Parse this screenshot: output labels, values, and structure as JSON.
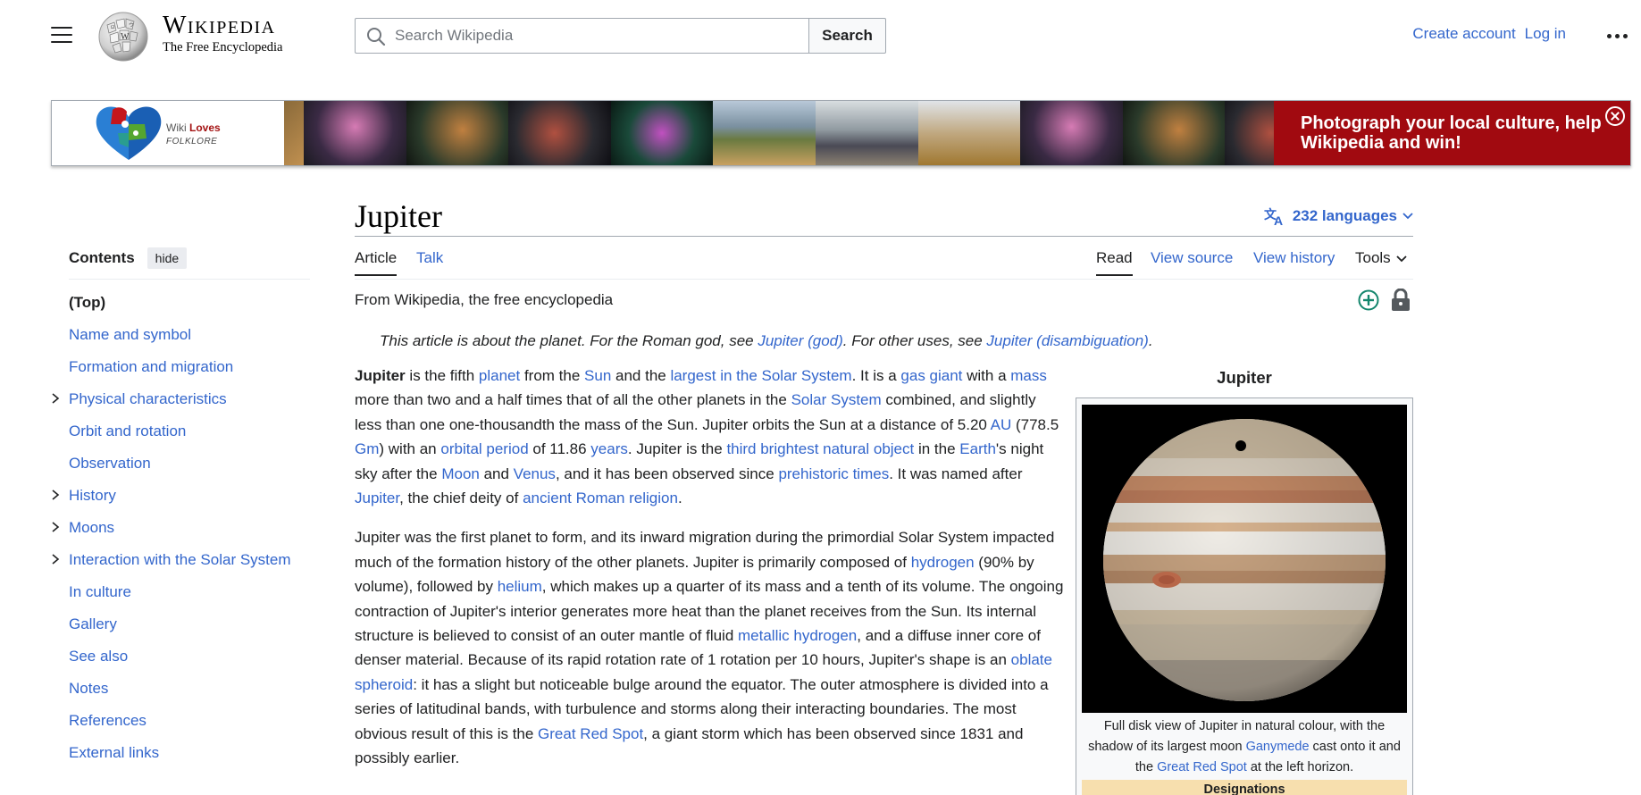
{
  "header": {
    "wordmark_name": "Wikipedia",
    "wordmark_tagline": "The Free Encyclopedia",
    "search_placeholder": "Search Wikipedia",
    "search_button": "Search",
    "create_account": "Create account",
    "log_in": "Log in"
  },
  "banner": {
    "logo_line1_a": "Wiki ",
    "logo_line1_b": "Loves",
    "logo_line2": "FOLKLORE",
    "cta": "Photograph your local culture, help Wikipedia and win!",
    "colors": {
      "cta_bg": "#a10a10"
    }
  },
  "toc": {
    "title": "Contents",
    "hide": "hide",
    "items": [
      {
        "label": "(Top)",
        "expandable": false
      },
      {
        "label": "Name and symbol",
        "expandable": false
      },
      {
        "label": "Formation and migration",
        "expandable": false
      },
      {
        "label": "Physical characteristics",
        "expandable": true
      },
      {
        "label": "Orbit and rotation",
        "expandable": false
      },
      {
        "label": "Observation",
        "expandable": false
      },
      {
        "label": "History",
        "expandable": true
      },
      {
        "label": "Moons",
        "expandable": true
      },
      {
        "label": "Interaction with the Solar System",
        "expandable": true
      },
      {
        "label": "In culture",
        "expandable": false
      },
      {
        "label": "Gallery",
        "expandable": false
      },
      {
        "label": "See also",
        "expandable": false
      },
      {
        "label": "Notes",
        "expandable": false
      },
      {
        "label": "References",
        "expandable": false
      },
      {
        "label": "External links",
        "expandable": false
      }
    ]
  },
  "article": {
    "title": "Jupiter",
    "languages": "232 languages",
    "tabs": {
      "article": "Article",
      "talk": "Talk",
      "read": "Read",
      "view_source": "View source",
      "view_history": "View history",
      "tools": "Tools"
    },
    "tagline": "From Wikipedia, the free encyclopedia",
    "hatnote": {
      "t1": "This article is about the planet. For the Roman god, see ",
      "l1": "Jupiter (god)",
      "t2": ". For other uses, see ",
      "l2": "Jupiter (disambiguation)",
      "t3": "."
    }
  },
  "infobox": {
    "title": "Jupiter",
    "caption_t1": "Full disk view of Jupiter in natural colour, with the shadow of its largest moon ",
    "caption_l1": "Ganymede",
    "caption_t2": " cast onto it and the ",
    "caption_l2": "Great Red Spot",
    "caption_t3": " at the left horizon.",
    "designations": "Designations"
  },
  "colors": {
    "link": "#3366cc",
    "text": "#202122",
    "border": "#a2a9b1"
  }
}
